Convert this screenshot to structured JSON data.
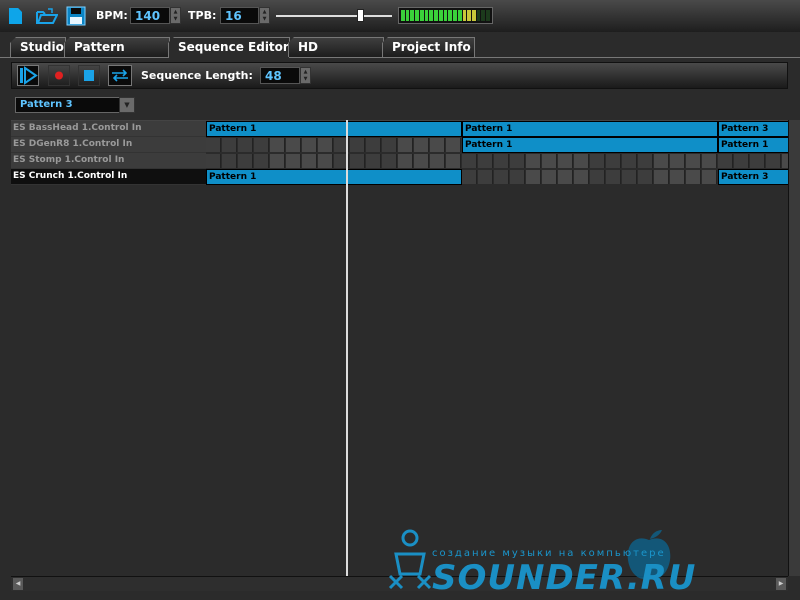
{
  "toolbar": {
    "icons": [
      "new-file-icon",
      "open-folder-icon",
      "save-disk-icon"
    ],
    "bpm_label": "BPM:",
    "bpm_value": "140",
    "tpb_label": "TPB:",
    "tpb_value": "16",
    "volume_level": 0.72,
    "meter_active_bars": 16,
    "meter_total_bars": 19
  },
  "tabs": [
    {
      "label": "Studio",
      "active": false
    },
    {
      "label": "Pattern Editor",
      "active": false
    },
    {
      "label": "Sequence Editor",
      "active": true
    },
    {
      "label": "HD Recorder",
      "active": false
    },
    {
      "label": "Project Info",
      "active": false
    }
  ],
  "sequence": {
    "buttons": [
      "play-icon",
      "record-icon",
      "stop-icon",
      "loop-icon"
    ],
    "length_label": "Sequence Length:",
    "length_value": "48",
    "pattern_selected": "Pattern 3"
  },
  "tracks": [
    {
      "name": "ES BassHead 1.Control In",
      "selected": false,
      "patterns": [
        {
          "label": "Pattern 1",
          "start_step": 0,
          "steps": 16
        },
        {
          "label": "Pattern 1",
          "start_step": 16,
          "steps": 16
        },
        {
          "label": "Pattern 3",
          "start_step": 32,
          "steps": 16
        }
      ]
    },
    {
      "name": "ES DGenR8 1.Control In",
      "selected": false,
      "patterns": [
        {
          "label": "Pattern 1",
          "start_step": 16,
          "steps": 16
        },
        {
          "label": "Pattern 1",
          "start_step": 32,
          "steps": 16
        }
      ]
    },
    {
      "name": "ES Stomp 1.Control In",
      "selected": false,
      "patterns": []
    },
    {
      "name": "ES Crunch 1.Control In",
      "selected": true,
      "patterns": [
        {
          "label": "Pattern 1",
          "start_step": 0,
          "steps": 16
        },
        {
          "label": "Pattern 3",
          "start_step": 32,
          "steps": 16
        }
      ]
    }
  ],
  "watermark": {
    "tagline": "создание музыки на компьютере",
    "brand": "SOUNDER.RU"
  },
  "colors": {
    "accent": "#0f8fc8",
    "value_text": "#5fc4ff",
    "background": "#2b2b2b"
  }
}
